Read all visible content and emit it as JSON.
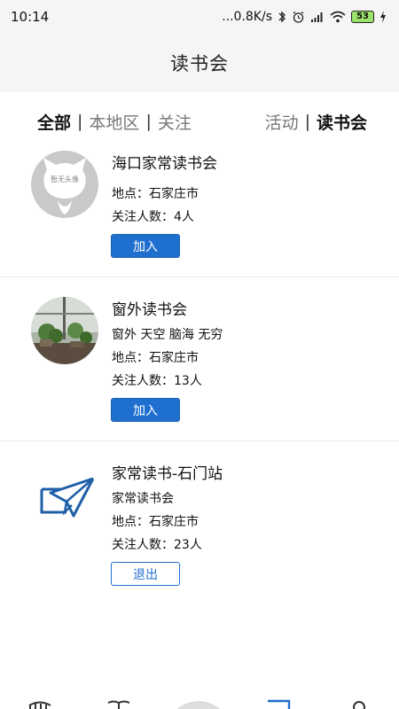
{
  "status_bar": {
    "time": "10:14",
    "network_speed": "...0.8K/s",
    "battery_level": "53",
    "icons": [
      "bluetooth-icon",
      "alarm-icon",
      "signal-hd-icon",
      "wifi-icon",
      "battery-icon",
      "charging-icon"
    ]
  },
  "header": {
    "title": "读书会"
  },
  "filters": {
    "left": [
      {
        "label": "全部",
        "active": true
      },
      {
        "label": "本地区",
        "active": false
      },
      {
        "label": "关注",
        "active": false
      }
    ],
    "right": [
      {
        "label": "活动",
        "active": false
      },
      {
        "label": "读书会",
        "active": true
      }
    ],
    "separator": "|"
  },
  "clubs": [
    {
      "name": "海口家常读书会",
      "avatar_text": "暂无头像",
      "location": "地点：石家庄市",
      "followers": "关注人数：4人",
      "button": "加入"
    },
    {
      "name": "窗外读书会",
      "tags": "窗外 天空 脑海 无穷",
      "location": "地点：石家庄市",
      "followers": "关注人数：13人",
      "button": "加入"
    },
    {
      "name": "家常读书-石门站",
      "description": "家常读书会",
      "location": "地点：石家庄市",
      "followers": "关注人数：23人",
      "button": "退出"
    }
  ],
  "colors": {
    "accent": "#1f6fcf",
    "header_bg": "#f5f5f5",
    "active_text": "#111111",
    "inactive_text": "#777777"
  }
}
